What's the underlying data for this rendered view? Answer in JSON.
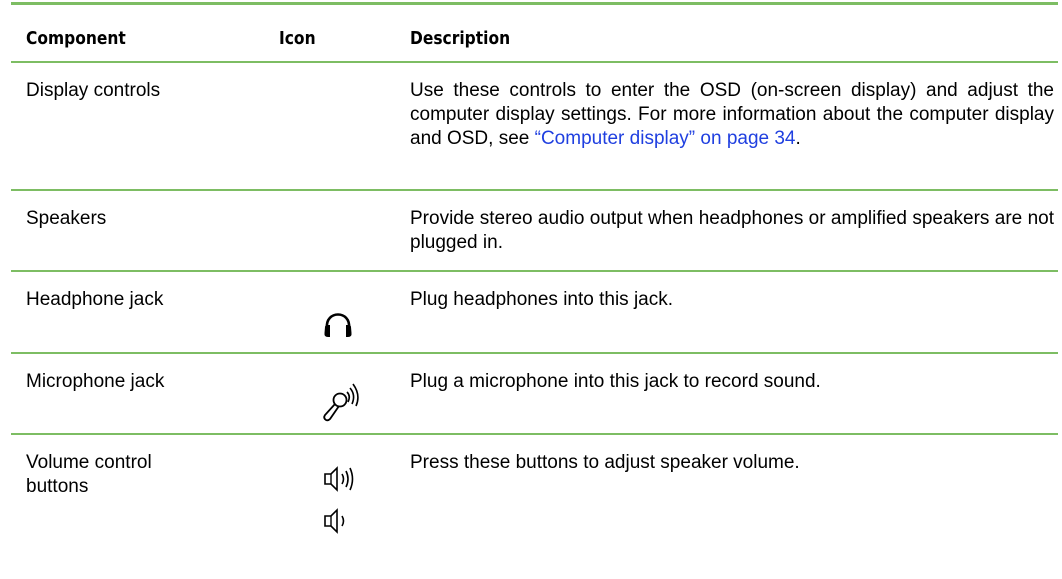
{
  "table": {
    "columns": [
      "Component",
      "Icon",
      "Description"
    ],
    "rows": [
      {
        "component": "Display controls",
        "icon": "",
        "description": "Use these controls to enter the OSD (on-screen display) and adjust the computer display settings. For more information about the computer display and OSD, see",
        "link": "“Computer display” on page 34",
        "after_link": "."
      },
      {
        "component": "Speakers",
        "icon": "",
        "description": "Provide stereo audio output when headphones or amplified speakers are not plugged in."
      },
      {
        "component": "Headphone jack",
        "icon": "headphones-icon",
        "description": "Plug headphones into this jack."
      },
      {
        "component": "Microphone jack",
        "icon": "microphone-icon",
        "description": "Plug a microphone into this jack to record sound."
      },
      {
        "component": "Volume control buttons",
        "icon": "volume-up-icon, volume-down-icon",
        "description": "Press these buttons to adjust speaker volume."
      }
    ]
  },
  "colors": {
    "rule": "#7dbd63",
    "link": "#1f3fe0"
  }
}
